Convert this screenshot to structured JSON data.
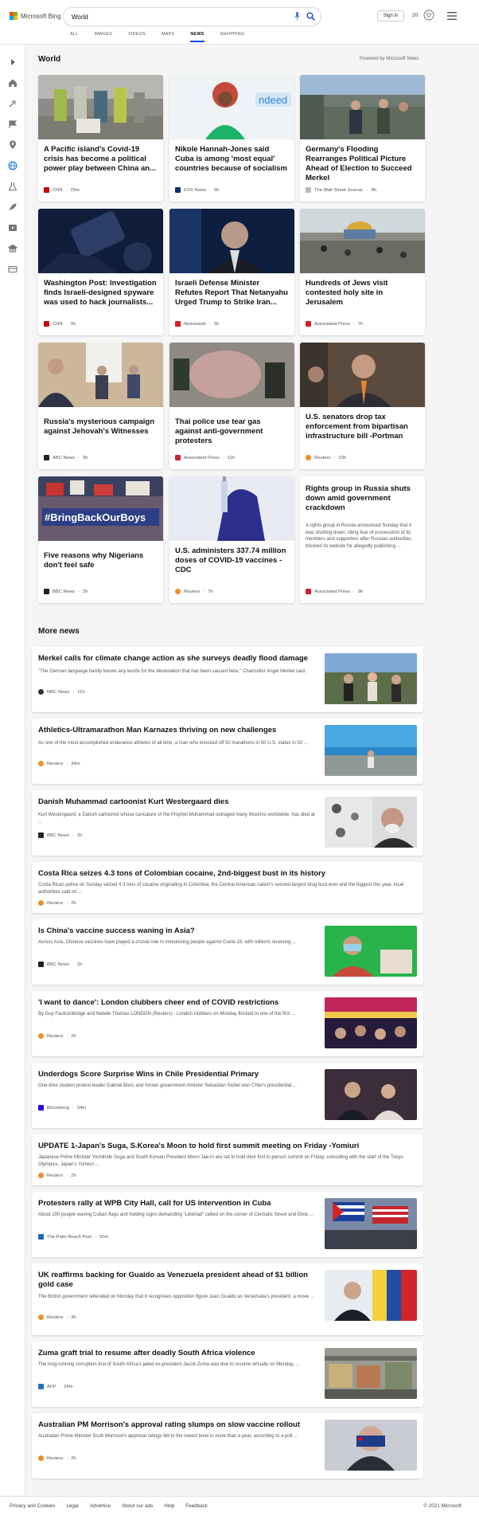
{
  "header": {
    "brand": "Microsoft Bing",
    "search_value": "World",
    "signin_label": "Sign in",
    "rewards_count": "20",
    "tabs": [
      {
        "label": "ALL"
      },
      {
        "label": "IMAGES"
      },
      {
        "label": "VIDEOS"
      },
      {
        "label": "MAPS"
      },
      {
        "label": "NEWS",
        "active": true
      },
      {
        "label": "SHOPPING"
      }
    ],
    "accent_color": "#174ae4"
  },
  "rail_icons": [
    "arrow-right-icon",
    "home-icon",
    "sports-icon",
    "flag-icon",
    "location-icon",
    "globe-icon",
    "science-icon",
    "rocket-icon",
    "video-icon",
    "bank-icon",
    "list-icon"
  ],
  "world": {
    "title": "World",
    "powered_by": "Powered by Microsoft News",
    "cards": [
      {
        "title": "A Pacific island's Covid-19 crisis has become a political power play between China an...",
        "source": "CNN",
        "time": "25m",
        "logo_color": "#cc0000"
      },
      {
        "title": "Nikole Hannah-Jones said Cuba is among 'most equal' countries because of socialism",
        "source": "FOX News",
        "time": "5h",
        "logo_color": "#003366"
      },
      {
        "title": "Germany's Flooding Rearranges Political Picture Ahead of Election to Succeed Merkel",
        "source": "The Wall Street Journal.",
        "time": "8h",
        "logo_color": "#bbbbbb"
      },
      {
        "title": "Washington Post: Investigation finds Israeli-designed spyware was used to hack journalists...",
        "source": "CNN",
        "time": "3h",
        "logo_color": "#cc0000"
      },
      {
        "title": "Israeli Defense Minister Refutes Report That Netanyahu Urged Trump to Strike Iran...",
        "source": "Newsweek",
        "time": "5h",
        "logo_color": "#e11b22"
      },
      {
        "title": "Hundreds of Jews visit contested holy site in Jerusalem",
        "source": "Associated Press",
        "time": "7h",
        "logo_color": "#d1202f"
      },
      {
        "title": "Russia's mysterious campaign against Jehovah's Witnesses",
        "source": "ABC News",
        "time": "9h",
        "logo_color": "#222222"
      },
      {
        "title": "Thai police use tear gas against anti-government protesters",
        "source": "Associated Press",
        "time": "11h",
        "logo_color": "#d1202f"
      },
      {
        "title": "U.S. senators drop tax enforcement from bipartisan infrastructure bill -Portman",
        "source": "Reuters",
        "time": "10h",
        "logo_color": "#f28c28"
      },
      {
        "title": "Five reasons why Nigerians don't feel safe",
        "source": "BBC News",
        "time": "2h",
        "logo_color": "#222222"
      },
      {
        "title": "U.S. administers 337.74 million doses of COVID-19 vaccines - CDC",
        "source": "Reuters",
        "time": "7h",
        "logo_color": "#f28c28"
      },
      {
        "title": "Rights group in Russia shuts down amid government crackdown",
        "description": "A rights group in Russia announced Sunday that it was shutting down, citing fear of prosecution of its members and supporters after Russian authorities blocked its website for allegedly publishing ...",
        "source": "Associated Press",
        "time": "9h",
        "logo_color": "#d1202f"
      }
    ]
  },
  "more_news": {
    "title": "More news",
    "items": [
      {
        "title": "Merkel calls for climate change action as she surveys deadly flood damage",
        "description": "\"The German language hardly knows any words for the devastation that has been caused here,\" Chancellor Angel Merkel said.",
        "source": "NBC News",
        "time": "11h",
        "logo_color": "#333333",
        "has_image": true
      },
      {
        "title": "Athletics-Ultramarathon Man Karnazes thriving on new challenges",
        "description": "As one of the most accomplished endurance athletes of all time, a man who knocked off 50 marathons in 50 U.S. states in 50 ...",
        "source": "Reuters",
        "time": "34m",
        "logo_color": "#f28c28",
        "has_image": true
      },
      {
        "title": "Danish Muhammad cartoonist Kurt Westergaard dies",
        "description": "Kurt Westergaard, a Danish cartoonist whose caricature of the Prophet Muhammad outraged many Muslims worldwide, has died at ...",
        "source": "BBC News",
        "time": "2h",
        "logo_color": "#222222",
        "has_image": true
      },
      {
        "title": "Costa Rica seizes 4.3 tons of Colombian cocaine, 2nd-biggest bust in its history",
        "description": "Costa Rican police on Sunday seized 4.3 tons of cocaine originating in Colombia, the Central American nation's second-largest drug bust ever and the biggest this year, local authorities said on ...",
        "source": "Reuters",
        "time": "2h",
        "logo_color": "#f28c28",
        "has_image": false
      },
      {
        "title": "Is China's vaccine success waning in Asia?",
        "description": "Across Asia, Chinese vaccines have played a crucial role in immunising people against Covid-19, with millions receiving ...",
        "source": "BBC News",
        "time": "2h",
        "logo_color": "#222222",
        "has_image": true
      },
      {
        "title": "'I want to dance': London clubbers cheer end of COVID restrictions",
        "description": "By Guy Faulconbridge and Natalie Thomas LONDON (Reuters) - London clubbers on Monday flocked to one of the first ...",
        "source": "Reuters",
        "time": "2h",
        "logo_color": "#f28c28",
        "has_image": true
      },
      {
        "title": "Underdogs Score Surprise Wins in Chile Presidential Primary",
        "description": "One-time student protest leader Gabriel Boric and former government minister Sebastian Sichel won Chile's presidential ...",
        "source": "Bloomberg",
        "time": "54m",
        "logo_color": "#2800d7",
        "has_image": true
      },
      {
        "title": "UPDATE 1-Japan's Suga, S.Korea's Moon to hold first summit meeting on Friday -Yomiuri",
        "description": "Japanese Prime Minister Yoshihide Suga and South Korean President Moon Jae-in are set to hold their first in-person summit on Friday, coinciding with the start of the Tokyo Olympics, Japan's Yomiuri ...",
        "source": "Reuters",
        "time": "2h",
        "logo_color": "#f28c28",
        "has_image": false
      },
      {
        "title": "Protesters rally at WPB City Hall, call for US intervention in Cuba",
        "description": "About 100 people waving Cuban flags and holding signs demanding \"Libertad\" rallied on the corner of Clematis Street and Dixie ...",
        "source": "The Palm Beach Post",
        "time": "50m",
        "logo_color": "#1a6bb5",
        "has_image": true
      },
      {
        "title": "UK reaffirms backing for Guaido as Venezuela president ahead of $1 billion gold case",
        "description": "The British government reiterated on Monday that it recognises opposition figure Juan Guaido as Venezuela's president, a move ...",
        "source": "Reuters",
        "time": "3h",
        "logo_color": "#f28c28",
        "has_image": true
      },
      {
        "title": "Zuma graft trial to resume after deadly South Africa violence",
        "description": "The long-running corruption trial of South Africa's jailed ex-president Jacob Zuma was due to resume virtually on Monday, ...",
        "source": "AFP",
        "time": "24m",
        "logo_color": "#1e73be",
        "has_image": true
      },
      {
        "title": "Australian PM Morrison's approval rating slumps on slow vaccine rollout",
        "description": "Australian Prime Minister Scott Morrison's approval ratings fell to the lowest level in more than a year, according to a poll ...",
        "source": "Reuters",
        "time": "2h",
        "logo_color": "#f28c28",
        "has_image": true
      }
    ]
  },
  "footer": {
    "links": [
      "Privacy and Cookies",
      "Legal",
      "Advertise",
      "About our ads",
      "Help",
      "Feedback"
    ],
    "copyright": "© 2021 Microsoft"
  }
}
